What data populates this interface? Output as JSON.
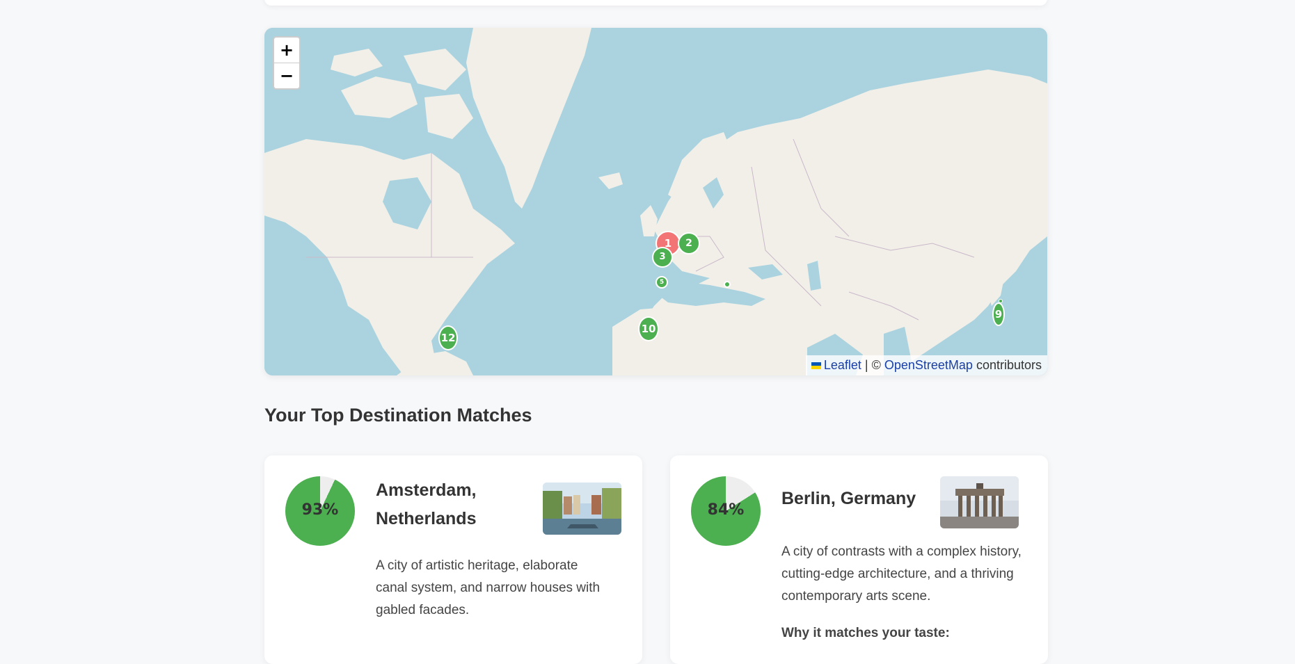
{
  "map": {
    "zoom_in_label": "+",
    "zoom_out_label": "−",
    "attribution": {
      "leaflet": "Leaflet",
      "separator": "| ©",
      "osm": "OpenStreetMap",
      "suffix": "contributors"
    },
    "markers": [
      {
        "label": "1",
        "color": "#f27474"
      },
      {
        "label": "2",
        "color": "#4caf50"
      },
      {
        "label": "3",
        "color": "#4caf50"
      },
      {
        "label": "5",
        "color": "#4caf50"
      },
      {
        "label": "10",
        "color": "#4caf50"
      },
      {
        "label": "12",
        "color": "#4caf50"
      },
      {
        "label": "9",
        "color": "#4caf50"
      }
    ],
    "colors": {
      "water": "#aad3df",
      "land": "#f2efe9",
      "border": "#c9b8c9"
    }
  },
  "section": {
    "title": "Your Top Destination Matches"
  },
  "destinations": [
    {
      "name": "Amsterdam, Netherlands",
      "match_percent": 93,
      "match_label": "93%",
      "description": "A city of artistic heritage, elaborate canal system, and narrow houses with gabled facades.",
      "thumbnail_icon": "canal-photo"
    },
    {
      "name": "Berlin, Germany",
      "match_percent": 84,
      "match_label": "84%",
      "description": "A city of contrasts with a complex history, cutting-edge architecture, and a thriving contemporary arts scene.",
      "why_label": "Why it matches your taste:",
      "thumbnail_icon": "brandenburg-gate-photo"
    }
  ],
  "colors": {
    "accent_green": "#4caf50",
    "accent_red": "#f27474",
    "pie_remainder": "#eeeeee"
  }
}
